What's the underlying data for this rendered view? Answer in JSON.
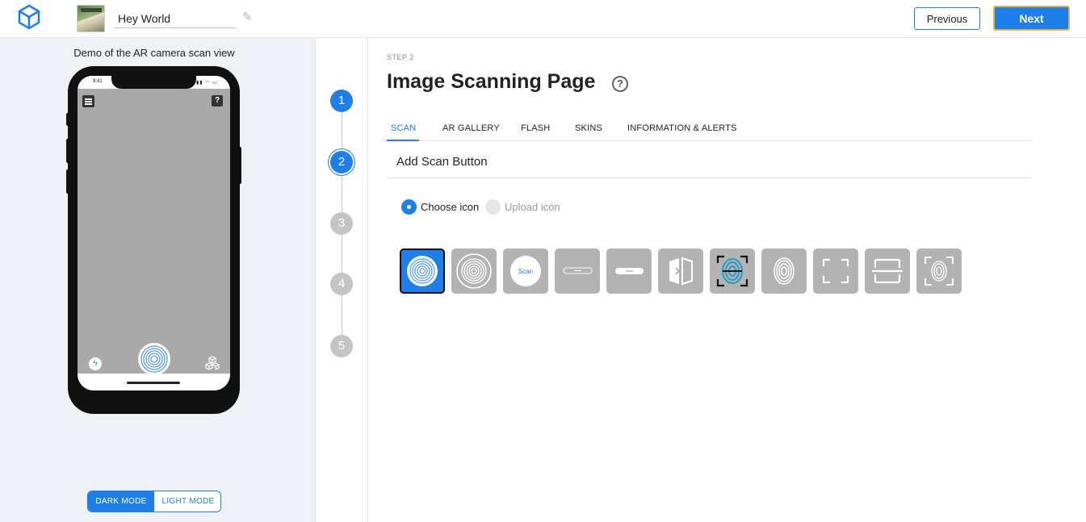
{
  "header": {
    "project_name": "Hey World",
    "previous_label": "Previous",
    "next_label": "Next"
  },
  "preview": {
    "title": "Demo of the AR camera scan view",
    "status_time": "9:41",
    "help_glyph": "?",
    "modes": {
      "dark": "DARK MODE",
      "light": "LIGHT MODE",
      "active": "dark"
    }
  },
  "stepper": {
    "steps": [
      "1",
      "2",
      "3",
      "4",
      "5"
    ],
    "current": 2
  },
  "main": {
    "step_label": "STEP 2",
    "title": "Image Scanning Page",
    "tabs": [
      {
        "label": "SCAN",
        "active": true
      },
      {
        "label": "AR GALLERY",
        "active": false
      },
      {
        "label": "FLASH",
        "active": false
      },
      {
        "label": "SKINS",
        "active": false
      },
      {
        "label": "INFORMATION & ALERTS",
        "active": false
      }
    ],
    "section_title": "Add Scan Button",
    "radio_choose": "Choose icon",
    "radio_upload": "Upload icon",
    "selected_radio": "choose",
    "icons": [
      {
        "name": "fingerprint-blue-icon",
        "text": ""
      },
      {
        "name": "fingerprint-outline-icon",
        "text": ""
      },
      {
        "name": "scan-circle-icon",
        "text": "Scan"
      },
      {
        "name": "scan-pill-outline-icon",
        "text": ""
      },
      {
        "name": "scan-pill-solid-icon",
        "text": ""
      },
      {
        "name": "split-scan-icon",
        "text": ""
      },
      {
        "name": "fingerprint-frame-cyan-icon",
        "text": ""
      },
      {
        "name": "fingerprint-white-icon",
        "text": ""
      },
      {
        "name": "scan-frame-corners-icon",
        "text": ""
      },
      {
        "name": "scan-frame-bar-icon",
        "text": ""
      },
      {
        "name": "fingerprint-frame-icon",
        "text": ""
      }
    ],
    "selected_icon": 0
  },
  "colors": {
    "accent": "#1e7fe8",
    "tile_gray": "#b3b3b3",
    "next_border": "#e3b34a"
  }
}
